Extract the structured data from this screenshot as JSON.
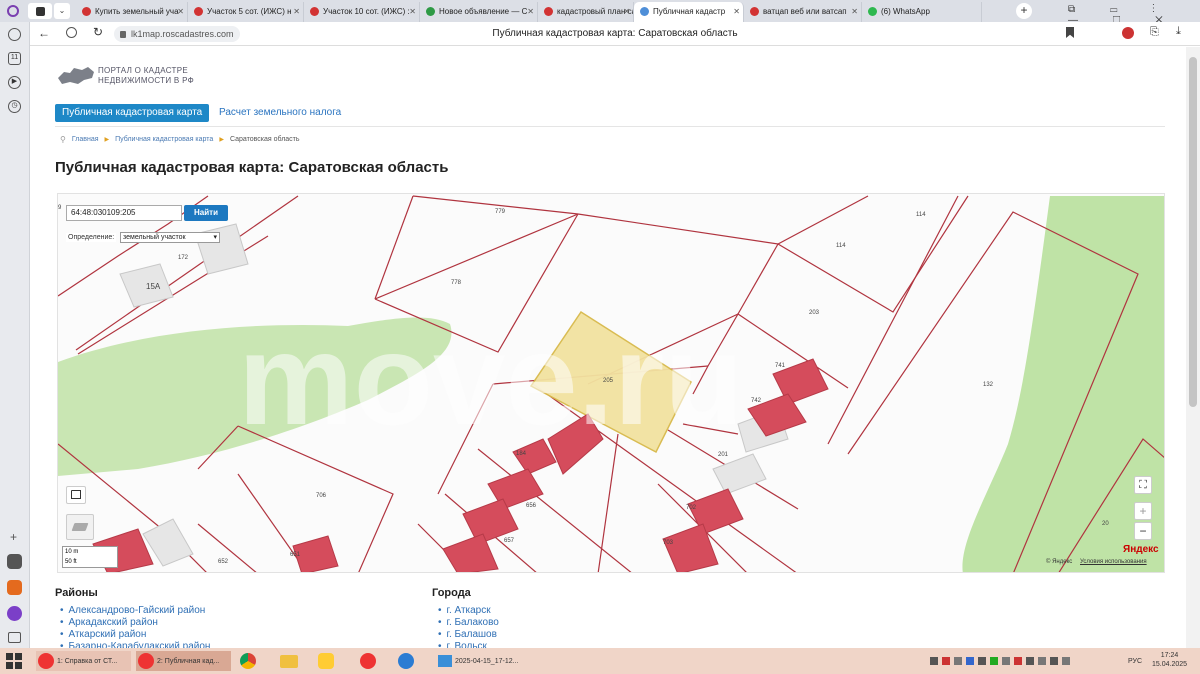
{
  "browser": {
    "tabs": [
      {
        "label": "Купить земельный уча",
        "color": "#d23333"
      },
      {
        "label": "Участок 5 сот. (ИЖС) н",
        "color": "#d23333"
      },
      {
        "label": "Участок 10 сот. (ИЖС) :",
        "color": "#d23333"
      },
      {
        "label": "Новое объявление — C",
        "color": "#2e9a45"
      },
      {
        "label": "кадастровый план сар",
        "color": "#d23333"
      },
      {
        "label": "Публичная кадастр",
        "color": "#4f8fd8"
      },
      {
        "label": "ватцап веб или ватсап",
        "color": "#d23333"
      },
      {
        "label": "(6) WhatsApp",
        "color": "#2eb84f"
      }
    ],
    "url": "lk1map.roscadastres.com",
    "page_title": "Публичная кадастровая карта: Саратовская область"
  },
  "site": {
    "logo_line1": "ПОРТАЛ О КАДАСТРЕ",
    "logo_line2": "НЕДВИЖИМОСТИ В РФ",
    "nav_active": "Публичная кадастровая карта",
    "nav_second": "Расчет земельного налога",
    "breadcrumb": [
      "Главная",
      "Публичная кадастровая карта",
      "Саратовская область"
    ],
    "heading": "Публичная кадастровая карта: Саратовская область"
  },
  "map": {
    "search_value": "64:48:030109:205",
    "find_label": "Найти",
    "definition_label": "Определение:",
    "definition_value": "земельный участок",
    "watermark": "move.ru",
    "scale_labels": [
      "10 m",
      "50 ft"
    ],
    "yandex_credit": "© Яндекс",
    "terms": "Условия использования",
    "yandex_logo": "Яндекс",
    "parcel_labels": [
      "779",
      "114",
      "114",
      "778",
      "203",
      "172",
      "15А",
      "205",
      "741",
      "742",
      "132",
      "201",
      "184",
      "706",
      "702",
      "703",
      "652",
      "651",
      "20",
      "657",
      "656",
      "9"
    ]
  },
  "lists": {
    "districts_title": "Районы",
    "districts": [
      "Александрово-Гайский район",
      "Аркадакский район",
      "Аткарский район",
      "Базарно-Карабулакский район"
    ],
    "cities_title": "Города",
    "cities": [
      "г. Аткарск",
      "г. Балаково",
      "г. Балашов",
      "г. Вольск"
    ]
  },
  "taskbar": {
    "item1": "1: Справка от СТ...",
    "item2": "2: Публичная кад...",
    "item3": "2025-04-15_17-12...",
    "lang": "РУС",
    "time": "17:24",
    "date": "15.04.2025"
  }
}
